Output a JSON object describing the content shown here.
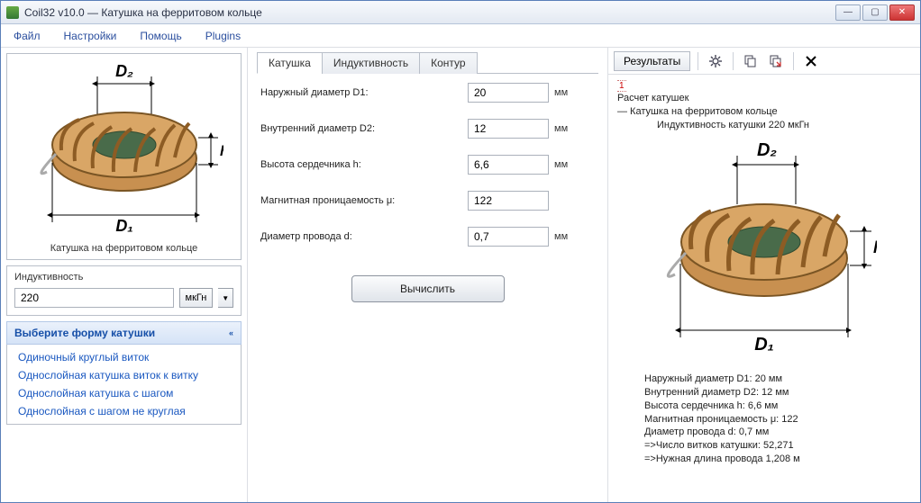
{
  "window": {
    "title": "Coil32 v10.0 — Катушка на ферритовом кольце",
    "buttons": {
      "min": "—",
      "max": "▢",
      "close": "✕"
    }
  },
  "menu": {
    "file": "Файл",
    "settings": "Настройки",
    "help": "Помощь",
    "plugins": "Plugins"
  },
  "left": {
    "caption": "Катушка на ферритовом кольце",
    "inductance": {
      "label": "Индуктивность",
      "value": "220",
      "unit": "мкГн",
      "dropdown": "▼"
    },
    "chooser": {
      "title": "Выберите форму катушки",
      "chev": "«"
    },
    "types": [
      "Одиночный круглый виток",
      "Однослойная катушка виток к витку",
      "Однослойная катушка с шагом",
      "Однослойная с шагом не круглая"
    ]
  },
  "center": {
    "tabs": {
      "t1": "Катушка",
      "t2": "Индуктивность",
      "t3": "Контур"
    },
    "rows": {
      "d1": {
        "label": "Наружный диаметр D1:",
        "value": "20",
        "unit": "мм"
      },
      "d2": {
        "label": "Внутренний диаметр D2:",
        "value": "12",
        "unit": "мм"
      },
      "h": {
        "label": "Высота сердечника h:",
        "value": "6,6",
        "unit": "мм"
      },
      "mu": {
        "label": "Магнитная проницаемость μ:",
        "value": "122",
        "unit": ""
      },
      "d": {
        "label": "Диаметр провода d:",
        "value": "0,7",
        "unit": "мм"
      }
    },
    "calc": "Вычислить"
  },
  "right": {
    "toolbar": {
      "results": "Результаты",
      "icons": {
        "gear": "⚙",
        "copy": "⧉",
        "paste": "⧉↘",
        "clear": "✖"
      }
    },
    "red1": "1",
    "l1": "Расчет катушек",
    "l2": "— Катушка на ферритовом кольце",
    "l3": "Индуктивность катушки 220 мкГн",
    "out": {
      "o1": "Наружный диаметр D1: 20 мм",
      "o2": "Внутренний диаметр D2: 12 мм",
      "o3": "Высота сердечника h: 6,6 мм",
      "o4": "Магнитная проницаемость μ: 122",
      "o5": "Диаметр провода d: 0,7 мм",
      "o6": "=>Число витков катушки: 52,271",
      "o7": "=>Нужная длина провода 1,208 м"
    }
  },
  "illus": {
    "D1": "D₁",
    "D2": "D₂",
    "h": "h"
  }
}
